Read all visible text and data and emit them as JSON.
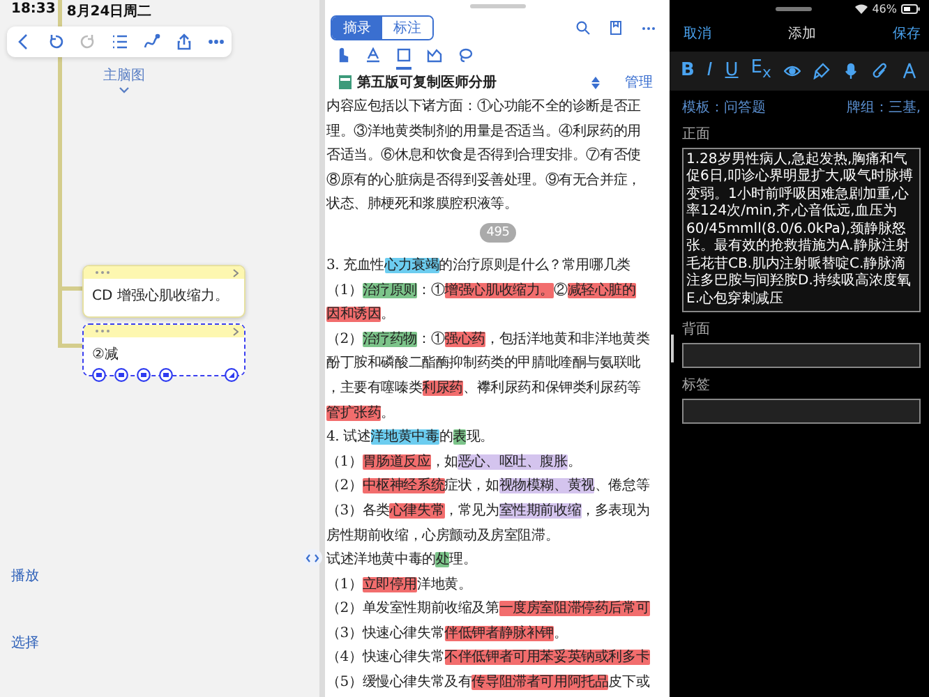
{
  "mind_map": {
    "status_bar": {
      "time": "18:33",
      "date": "8月24日周二"
    },
    "toolbar": [
      {
        "kind": "back",
        "disabled": false
      },
      {
        "kind": "undo",
        "disabled": false
      },
      {
        "kind": "redo",
        "disabled": true
      },
      {
        "kind": "list",
        "disabled": false
      },
      {
        "kind": "curve",
        "disabled": false
      },
      {
        "kind": "share",
        "disabled": false
      },
      {
        "kind": "more",
        "disabled": false
      }
    ],
    "map_title": "主脑图",
    "nodes": [
      {
        "text": "CD 增强心肌收缩力。",
        "selected": false
      },
      {
        "text": "②减",
        "selected": true
      }
    ],
    "side_buttons": [
      "播放",
      "选择"
    ]
  },
  "document": {
    "tabs": [
      {
        "label": "摘录",
        "selected": true
      },
      {
        "label": "标注",
        "selected": false
      }
    ],
    "tools": [
      {
        "kind": "pointer",
        "selected": false
      },
      {
        "kind": "text",
        "selected": false
      },
      {
        "kind": "rectangle",
        "selected": true
      },
      {
        "kind": "marker",
        "selected": false
      },
      {
        "kind": "lasso",
        "selected": false
      }
    ],
    "book_title": "第五版可复制医师分册",
    "manage": "管理",
    "page_number": "495",
    "top_lines": [
      {
        "segments": [
          {
            "text": "内容应包括以下诸方面：①心功能不全的诊断是否正"
          }
        ]
      },
      {
        "segments": [
          {
            "text": "理。③洋地黄类制剂的用量是否适当。④利尿药的用"
          }
        ]
      },
      {
        "segments": [
          {
            "text": "否适当。⑥休息和饮食是否得到合理安排。⑦有否使"
          }
        ]
      },
      {
        "segments": [
          {
            "text": "⑧原有的心脏病是否得到妥善处理。⑨有无合并症，"
          }
        ]
      },
      {
        "segments": [
          {
            "text": "状态、肺梗死和浆膜腔积液等。"
          }
        ]
      }
    ],
    "lines": [
      {
        "segments": [
          {
            "text": "3. 充血性"
          },
          {
            "text": "心力衰竭",
            "color": "#6ccdf0"
          },
          {
            "text": "的治疗原则是什么？常用哪几类"
          }
        ]
      },
      {
        "segments": [
          {
            "text": "（1）"
          },
          {
            "text": "治疗原则",
            "color": "#7cc48a"
          },
          {
            "text": "：①"
          },
          {
            "text": "增强心肌收缩力。",
            "color": "#f26d6d"
          },
          {
            "text": "②"
          },
          {
            "text": "减轻心脏的",
            "color": "#f26d6d"
          }
        ]
      },
      {
        "segments": [
          {
            "text": "因和诱因",
            "color": "#f26d6d"
          },
          {
            "text": "。"
          }
        ]
      },
      {
        "segments": [
          {
            "text": "（2）"
          },
          {
            "text": "治疗药物",
            "color": "#7cc48a"
          },
          {
            "text": "：①"
          },
          {
            "text": "强心药",
            "color": "#f26d6d"
          },
          {
            "text": "，包括洋地黄和非洋地黄类"
          }
        ]
      },
      {
        "segments": [
          {
            "text": "酚丁胺和磷酸二酯酶抑制药类的甲腈吡喹酮与氨联吡"
          }
        ]
      },
      {
        "segments": [
          {
            "text": "，主要有噻嗪类"
          },
          {
            "text": "利尿药",
            "color": "#f26d6d"
          },
          {
            "text": "、襻利尿药和保钾类利尿药等"
          }
        ]
      },
      {
        "segments": [
          {
            "text": "管扩张药",
            "color": "#f26d6d"
          },
          {
            "text": "。"
          }
        ]
      },
      {
        "segments": [
          {
            "text": "4. 试述"
          },
          {
            "text": "洋地黄中毒",
            "color": "#6ccdf0"
          },
          {
            "text": "的"
          },
          {
            "text": "表",
            "color": "#7cc48a"
          },
          {
            "text": "现。"
          }
        ]
      },
      {
        "segments": [
          {
            "text": "（1）"
          },
          {
            "text": "胃肠道反应",
            "color": "#f26d6d"
          },
          {
            "text": "，如"
          },
          {
            "text": "恶心、呕吐、腹胀",
            "color": "#d4c4ee"
          },
          {
            "text": "。"
          }
        ]
      },
      {
        "segments": [
          {
            "text": "（2）"
          },
          {
            "text": "中枢神经系统",
            "color": "#f26d6d"
          },
          {
            "text": "症状，如"
          },
          {
            "text": "视物模糊、黄视",
            "color": "#d4c4ee"
          },
          {
            "text": "、倦怠等"
          }
        ]
      },
      {
        "segments": [
          {
            "text": "（3）各类"
          },
          {
            "text": "心律失常",
            "color": "#f26d6d"
          },
          {
            "text": "，常见为"
          },
          {
            "text": "室性期前收缩",
            "color": "#d4c4ee"
          },
          {
            "text": "，多表现为"
          }
        ]
      },
      {
        "segments": [
          {
            "text": "房性期前收缩，心房颤动及房室阻滞。"
          }
        ]
      },
      {
        "segments": [
          {
            "text": "试述洋地黄中毒的"
          },
          {
            "text": "处",
            "color": "#7cc48a"
          },
          {
            "text": "理。"
          }
        ]
      },
      {
        "segments": [
          {
            "text": "（1）"
          },
          {
            "text": "立即停用",
            "color": "#f26d6d"
          },
          {
            "text": "洋地黄。"
          }
        ]
      },
      {
        "segments": [
          {
            "text": "（2）单发室性期前收缩及第"
          },
          {
            "text": "一度房室阻滞停药后常可",
            "color": "#f26d6d"
          }
        ]
      },
      {
        "segments": [
          {
            "text": "（3）快速心律失常"
          },
          {
            "text": "伴低钾者静脉补钾",
            "color": "#f26d6d"
          },
          {
            "text": "。"
          }
        ]
      },
      {
        "segments": [
          {
            "text": "（4）快速心律失常"
          },
          {
            "text": "不伴低钾者可用苯妥英钠或利多卡",
            "color": "#f26d6d"
          }
        ]
      },
      {
        "segments": [
          {
            "text": "（5）缓慢心律失常及有"
          },
          {
            "text": "传导阻滞者可用阿托品",
            "color": "#f26d6d"
          },
          {
            "text": "皮下或"
          }
        ]
      }
    ]
  },
  "card_editor": {
    "battery": "46%",
    "cancel": "取消",
    "title": "添加",
    "save": "保存",
    "format_tools": [
      {
        "kind": "bold",
        "label": "B"
      },
      {
        "kind": "italic",
        "label": "I"
      },
      {
        "kind": "underline",
        "label": "U"
      },
      {
        "kind": "clear",
        "label": "E$_{x}$"
      },
      {
        "kind": "eye"
      },
      {
        "kind": "highlighter"
      },
      {
        "kind": "mic"
      },
      {
        "kind": "clip"
      },
      {
        "kind": "nib"
      }
    ],
    "template": "模板：问答题",
    "deck": "牌组：三基,",
    "fields": [
      {
        "label": "正面",
        "value": "1.28岁男性病人,急起发热,胸痛和气促6日,叩诊心界明显扩大,吸气时脉搏变弱。1小时前呼吸困难急剧加重,心率124次/min,齐,心音低远,血压为60/45mmll(8.0/6.0kPa),颈静脉怒张。最有效的抢救措施为A.静脉注射毛花苷CB.肌内注射哌替啶C.静脉滴注多巴胺与间羟胺D.持续吸高浓度氧E.心包穿刺减压"
      },
      {
        "label": "背面"
      },
      {
        "label": "标签"
      }
    ]
  }
}
